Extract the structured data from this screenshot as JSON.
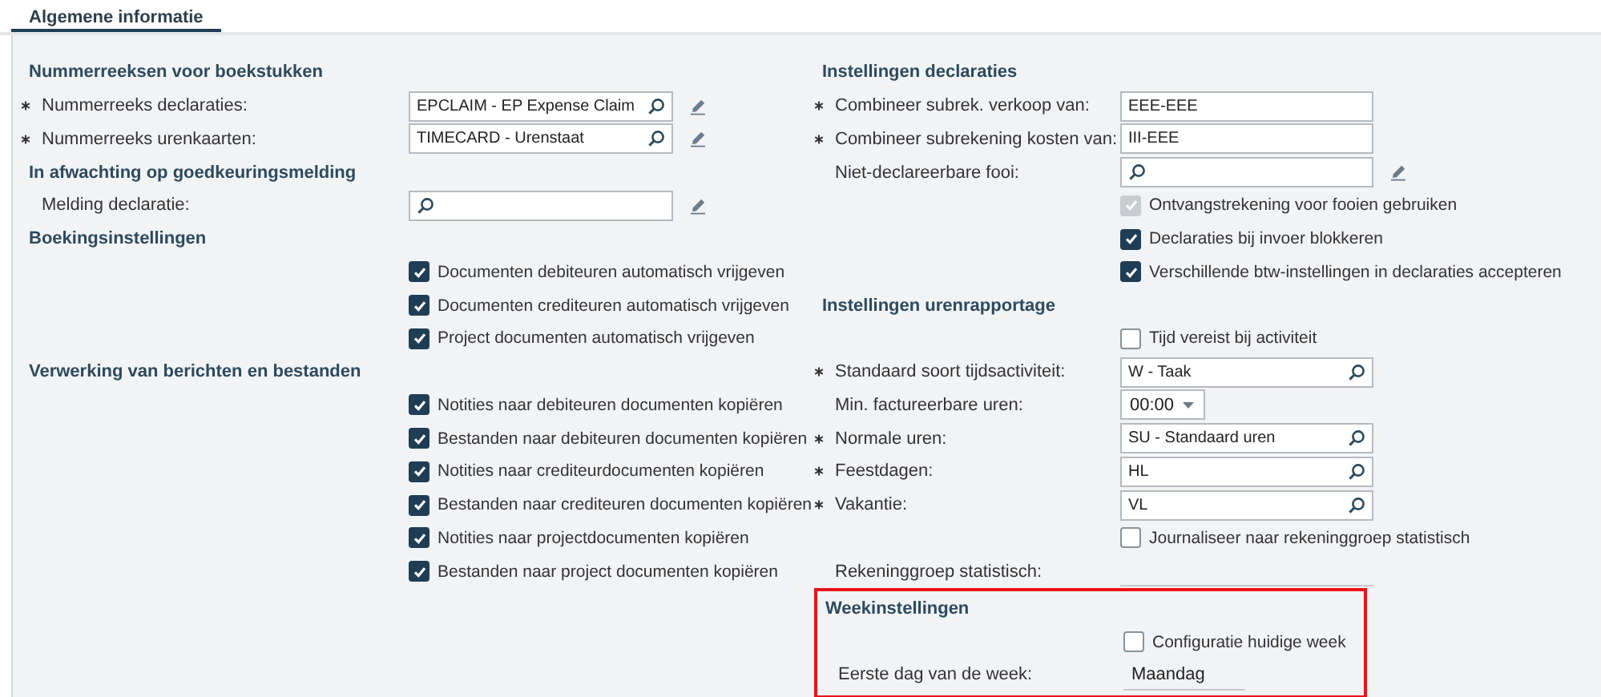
{
  "tabs": [
    {
      "label": "Algemene informatie",
      "selected": true
    }
  ],
  "left_column": [
    {
      "kind": "heading",
      "text": "Nummerreeksen voor boekstukken"
    },
    {
      "kind": "field",
      "label": "Nummerreeks declaraties:",
      "required": true,
      "value": "EPCLAIM - EP Expense Claim",
      "lookup": true,
      "editable": true
    },
    {
      "kind": "field",
      "label": "Nummerreeks urenkaarten:",
      "required": true,
      "value": "TIMECARD - Urenstaat",
      "lookup": true,
      "editable": true
    },
    {
      "kind": "heading",
      "text": "In afwachting op goedkeuringsmelding"
    },
    {
      "kind": "field",
      "label": "Melding declaratie:",
      "required": false,
      "lookup": true,
      "editable": true
    },
    {
      "kind": "heading",
      "text": "Boekingsinstellingen"
    },
    {
      "kind": "checkbox",
      "text": "Documenten debiteuren automatisch vrijgeven",
      "checked": true,
      "disabled": false
    },
    {
      "kind": "checkbox",
      "text": "Documenten crediteuren automatisch vrijgeven",
      "checked": true,
      "disabled": false
    },
    {
      "kind": "checkbox",
      "text": "Project documenten automatisch vrijgeven",
      "checked": true,
      "disabled": false
    },
    {
      "kind": "heading",
      "text": "Verwerking van berichten en bestanden"
    },
    {
      "kind": "checkbox",
      "text": "Notities naar debiteuren documenten kopiëren",
      "checked": true,
      "disabled": false
    },
    {
      "kind": "checkbox",
      "text": "Bestanden naar debiteuren documenten kopiëren",
      "checked": true,
      "disabled": false
    },
    {
      "kind": "checkbox",
      "text": "Notities naar crediteurdocumenten kopiëren",
      "checked": true,
      "disabled": false
    },
    {
      "kind": "checkbox",
      "text": "Bestanden naar crediteuren documenten kopiëren",
      "checked": true,
      "disabled": false
    },
    {
      "kind": "checkbox",
      "text": "Notities naar projectdocumenten kopiëren",
      "checked": true,
      "disabled": false
    },
    {
      "kind": "checkbox",
      "text": "Bestanden naar project documenten kopiëren",
      "checked": true,
      "disabled": false
    }
  ],
  "right_column": [
    {
      "kind": "heading",
      "text": "Instellingen declaraties"
    },
    {
      "kind": "field",
      "label": "Combineer subrek. verkoop van:",
      "required": true,
      "value": "EEE-EEE",
      "lookup": false,
      "editable": false
    },
    {
      "kind": "field",
      "label": "Combineer subrekening kosten van:",
      "required": true,
      "value": "III-EEE",
      "lookup": false,
      "editable": false
    },
    {
      "kind": "field",
      "label": "Niet-declareerbare fooi:",
      "required": false,
      "lookup": true,
      "editable": true
    },
    {
      "kind": "checkbox",
      "text": "Ontvangstrekening voor fooien gebruiken",
      "checked": true,
      "disabled": true
    },
    {
      "kind": "checkbox",
      "text": "Declaraties bij invoer blokkeren",
      "checked": true,
      "disabled": false
    },
    {
      "kind": "checkbox",
      "text": "Verschillende btw-instellingen in declaraties accepteren",
      "checked": true,
      "disabled": false
    },
    {
      "kind": "heading",
      "text": "Instellingen urenrapportage"
    },
    {
      "kind": "checkbox",
      "text": "Tijd vereist bij activiteit",
      "checked": false,
      "disabled": false
    },
    {
      "kind": "field",
      "label": "Standaard soort tijdsactiviteit:",
      "required": true,
      "value": "W - Taak",
      "lookup": true,
      "editable": false
    },
    {
      "kind": "select",
      "label": "Min. factureerbare uren:",
      "required": false,
      "value": "00:00"
    },
    {
      "kind": "field",
      "label": "Normale uren:",
      "required": true,
      "value": "SU - Standaard uren",
      "lookup": true,
      "editable": false
    },
    {
      "kind": "field",
      "label": "Feestdagen:",
      "required": true,
      "value": "HL",
      "lookup": true,
      "editable": false
    },
    {
      "kind": "field",
      "label": "Vakantie:",
      "required": true,
      "value": "VL",
      "lookup": true,
      "editable": false
    },
    {
      "kind": "checkbox",
      "text": "Journaliseer naar rekeninggroep statistisch",
      "checked": false,
      "disabled": false
    },
    {
      "kind": "display",
      "label": "Rekeninggroep statistisch:",
      "required": false
    }
  ],
  "week_settings": {
    "highlighted": true,
    "rows": [
      {
        "kind": "heading",
        "text": "Weekinstellingen"
      },
      {
        "kind": "checkbox",
        "text": "Configuratie huidige week",
        "checked": false,
        "disabled": false
      },
      {
        "kind": "display",
        "label": "Eerste dag van de week:",
        "required": false,
        "value": "Maandag"
      }
    ]
  }
}
